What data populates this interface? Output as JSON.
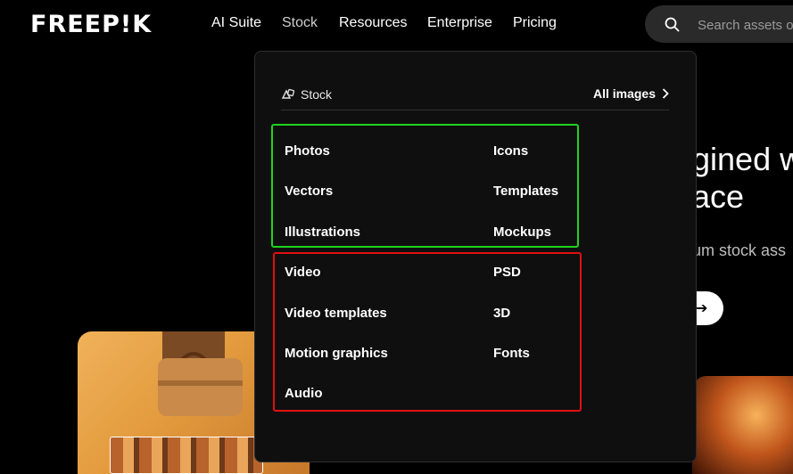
{
  "brand": {
    "logo": "FREEP!K"
  },
  "nav": {
    "items": [
      {
        "label": "AI Suite"
      },
      {
        "label": "Stock"
      },
      {
        "label": "Resources"
      },
      {
        "label": "Enterprise"
      },
      {
        "label": "Pricing"
      }
    ]
  },
  "search": {
    "placeholder": "Search assets o",
    "icon": "search-icon"
  },
  "hero": {
    "title_line1": "gined w",
    "title_line2": "ace",
    "subtitle": "um stock ass",
    "button_icon": "arrow-right-icon"
  },
  "dropdown": {
    "section_label": "Stock",
    "section_icon": "stock-icon",
    "all_link": "All images",
    "green_group": {
      "left": [
        "Photos",
        "Vectors",
        "Illustrations"
      ],
      "right": [
        "Icons",
        "Templates",
        "Mockups"
      ]
    },
    "red_group": {
      "left": [
        "Video",
        "Video templates",
        "Motion graphics",
        "Audio"
      ],
      "right": [
        "PSD",
        "3D",
        "Fonts"
      ]
    }
  },
  "colors": {
    "highlight_green": "#1fd21f",
    "highlight_red": "#e01010",
    "menu_bg": "#0f0f0f"
  }
}
